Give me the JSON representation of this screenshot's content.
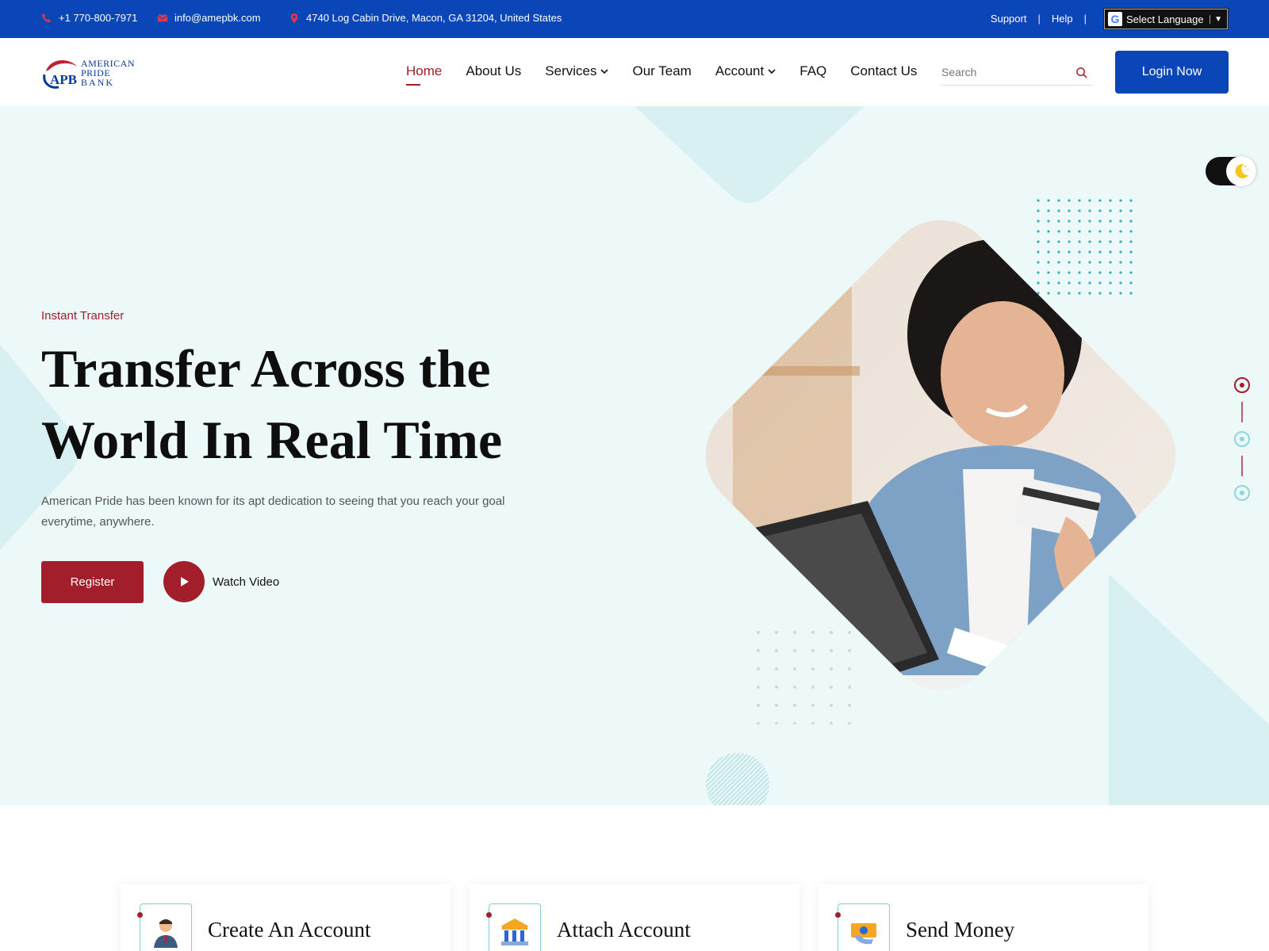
{
  "topbar": {
    "phone": "+1 770-800-7971",
    "email": "info@amepbk.com",
    "address": "4740 Log Cabin Drive, Macon, GA 31204, United States",
    "links": [
      "Support",
      "Help"
    ],
    "separator": "|",
    "language_label": "Select Language",
    "language_arrow": "▼",
    "google_glyph": "G"
  },
  "logo": {
    "initials": "APB",
    "line1": "AMERICAN",
    "line2": "PRIDE",
    "line3": "BANK"
  },
  "nav": {
    "items": [
      {
        "label": "Home",
        "active": true,
        "dropdown": false
      },
      {
        "label": "About Us",
        "active": false,
        "dropdown": false
      },
      {
        "label": "Services",
        "active": false,
        "dropdown": true
      },
      {
        "label": "Our Team",
        "active": false,
        "dropdown": false
      },
      {
        "label": "Account",
        "active": false,
        "dropdown": true
      },
      {
        "label": "FAQ",
        "active": false,
        "dropdown": false
      },
      {
        "label": "Contact Us",
        "active": false,
        "dropdown": false
      }
    ],
    "search_placeholder": "Search",
    "login_label": "Login Now"
  },
  "hero": {
    "eyebrow": "Instant Transfer",
    "headline_line1": "Transfer Across the",
    "headline_line2": "World In Real Time",
    "description": "American Pride has been known for its apt dedication to seeing that you reach your goal everytime, anywhere.",
    "register_label": "Register",
    "watch_label": "Watch Video"
  },
  "cards": [
    {
      "title": "Create An Account",
      "icon": "user-icon"
    },
    {
      "title": "Attach Account",
      "icon": "bank-icon"
    },
    {
      "title": "Send Money",
      "icon": "money-icon"
    }
  ],
  "colors": {
    "primary": "#0b46b8",
    "accent": "#a31e2b",
    "hero_bg": "#edf8f8",
    "teal": "#8ed6dd"
  }
}
